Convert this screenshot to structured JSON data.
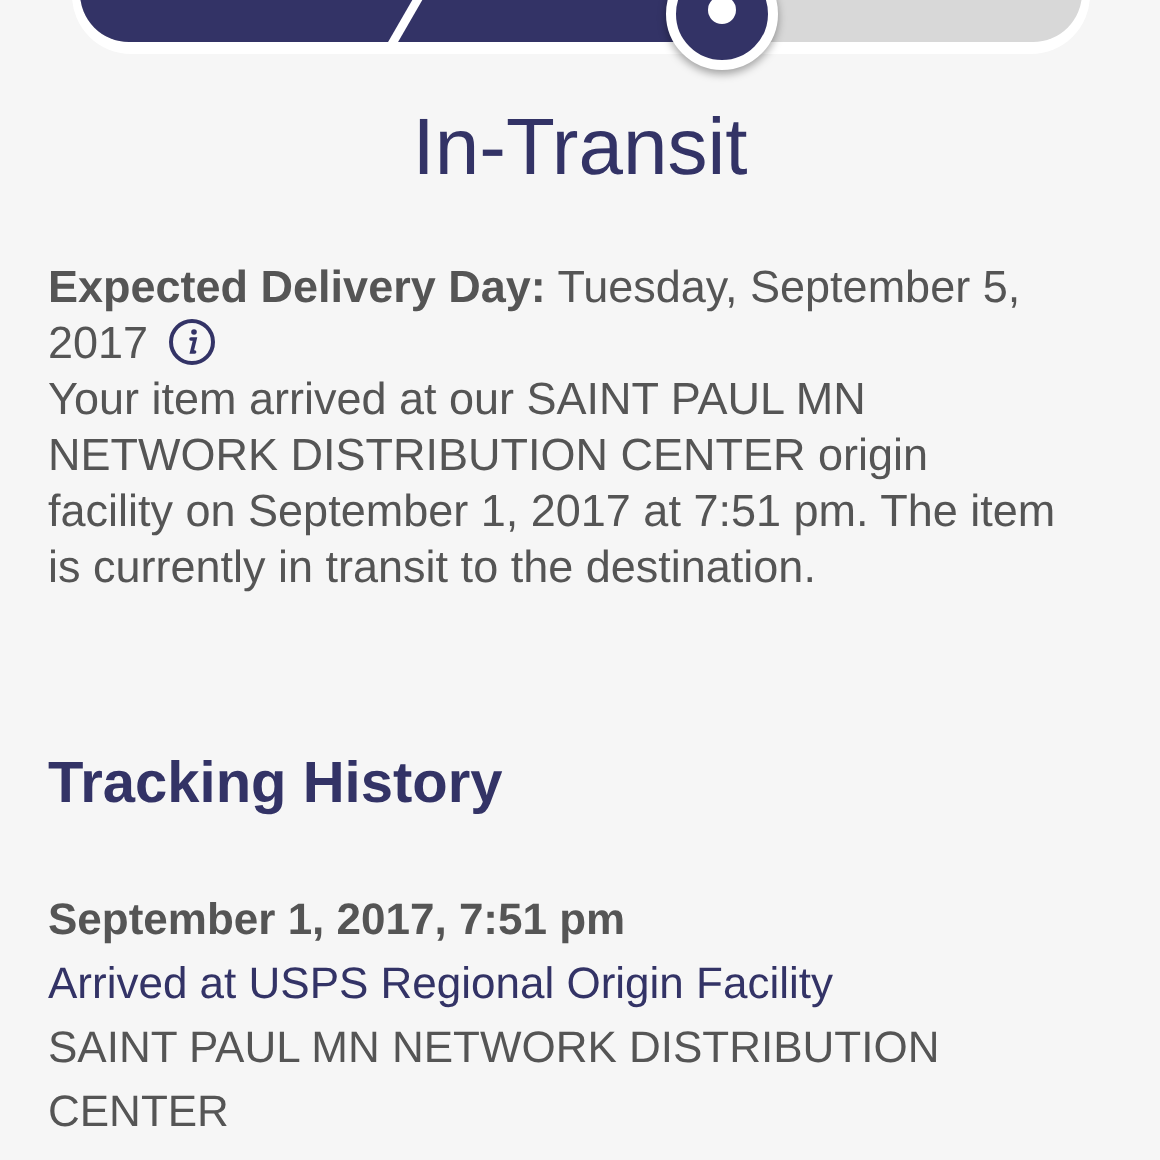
{
  "status": "In-Transit",
  "expected": {
    "label": "Expected Delivery Day:",
    "value": "Tuesday, September 5, 2017"
  },
  "message": "Your item arrived at our SAINT PAUL MN NETWORK DISTRIBUTION CENTER origin facility on September 1, 2017 at 7:51 pm. The item is currently in transit to the destination.",
  "history": {
    "title": "Tracking History",
    "events": [
      {
        "date": "September 1, 2017, 7:51 pm",
        "status": "Arrived at USPS Regional Origin Facility",
        "location": "SAINT PAUL MN NETWORK DISTRIBUTION CENTER"
      }
    ]
  }
}
